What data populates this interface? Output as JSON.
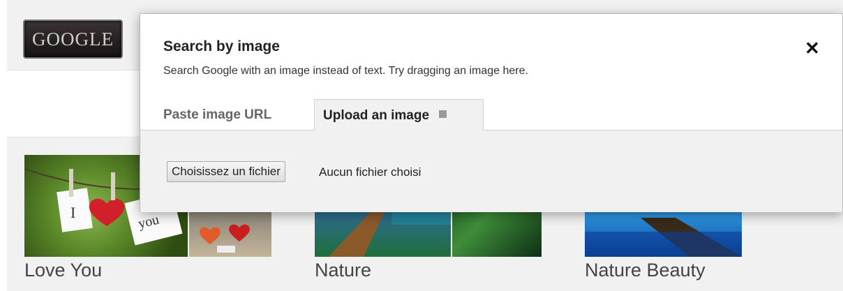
{
  "header": {
    "logo_text": "GOOGLE"
  },
  "cards": [
    {
      "label": "Love You"
    },
    {
      "label": "Nature"
    },
    {
      "label": "Nature Beauty"
    }
  ],
  "dialog": {
    "title": "Search by image",
    "subtitle": "Search Google with an image instead of text. Try dragging an image here.",
    "close_symbol": "✕",
    "tabs": [
      {
        "label": "Paste image URL",
        "active": false
      },
      {
        "label": "Upload an image",
        "active": true
      }
    ],
    "help_icon": "help-icon",
    "file_input": {
      "button_label": "Choisissez un fichier",
      "status": "Aucun fichier choisi"
    }
  },
  "colors": {
    "panel_bg": "#f1f1f1",
    "dialog_bg": "#ffffff"
  }
}
